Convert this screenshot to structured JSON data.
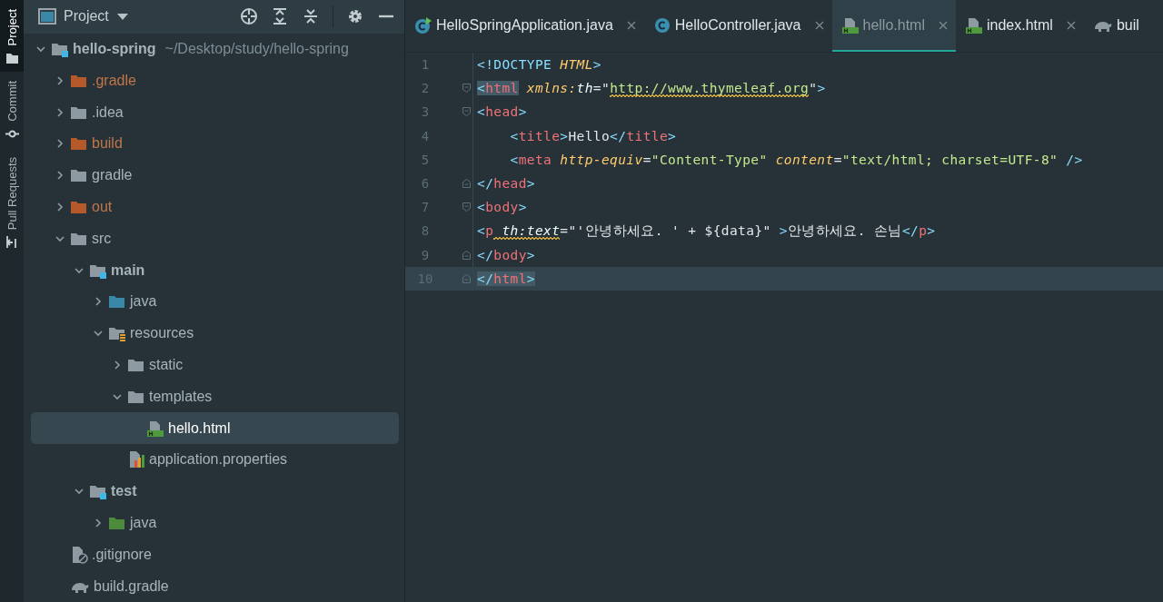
{
  "sidebar_tabs": [
    {
      "label": "Project",
      "kind": "folder",
      "selected": true
    },
    {
      "label": "Commit",
      "kind": "commit",
      "selected": false
    },
    {
      "label": "Pull Requests",
      "kind": "pull-request",
      "selected": false
    }
  ],
  "project_panel": {
    "title": "Project"
  },
  "tree": [
    {
      "name": "hello-spring",
      "path": "~/Desktop/study/hello-spring",
      "kind": "module",
      "expanded": true,
      "selected": false,
      "children": [
        {
          "name": ".gradle",
          "kind": "excluded",
          "expanded": false,
          "selected": false
        },
        {
          "name": ".idea",
          "kind": "folder",
          "expanded": false,
          "selected": false
        },
        {
          "name": "build",
          "kind": "excluded",
          "expanded": false,
          "selected": false
        },
        {
          "name": "gradle",
          "kind": "folder",
          "expanded": false,
          "selected": false
        },
        {
          "name": "out",
          "kind": "excluded",
          "expanded": false,
          "selected": false
        },
        {
          "name": "src",
          "kind": "folder",
          "expanded": true,
          "selected": false,
          "children": [
            {
              "name": "main",
              "kind": "module",
              "expanded": true,
              "selected": false,
              "children": [
                {
                  "name": "java",
                  "kind": "source",
                  "expanded": false,
                  "selected": false
                },
                {
                  "name": "resources",
                  "kind": "resources",
                  "expanded": true,
                  "selected": false,
                  "children": [
                    {
                      "name": "static",
                      "kind": "folder",
                      "expanded": false,
                      "selected": false
                    },
                    {
                      "name": "templates",
                      "kind": "folder",
                      "expanded": true,
                      "selected": false,
                      "children": [
                        {
                          "name": "hello.html",
                          "kind": "html",
                          "selected": true
                        }
                      ]
                    },
                    {
                      "name": "application.properties",
                      "kind": "properties",
                      "selected": false
                    }
                  ]
                }
              ]
            },
            {
              "name": "test",
              "kind": "module",
              "expanded": true,
              "selected": false,
              "children": [
                {
                  "name": "java",
                  "kind": "test-source",
                  "expanded": false,
                  "selected": false
                }
              ]
            }
          ]
        },
        {
          "name": ".gitignore",
          "kind": "gitignore",
          "selected": false
        },
        {
          "name": "build.gradle",
          "kind": "gradle",
          "selected": false
        }
      ]
    }
  ],
  "editor_tabs": [
    {
      "label": "HelloSpringApplication.java",
      "kind": "app",
      "selected": false,
      "closable": true
    },
    {
      "label": "HelloController.java",
      "kind": "class",
      "selected": false,
      "closable": true
    },
    {
      "label": "hello.html",
      "kind": "html",
      "selected": true,
      "closable": true
    },
    {
      "label": "index.html",
      "kind": "html",
      "selected": false,
      "closable": true
    },
    {
      "label": "buil",
      "kind": "gradle",
      "selected": false,
      "closable": false
    }
  ],
  "code_lines": [
    {
      "number": "1",
      "current": false,
      "kind": "plain",
      "tokens": [
        {
          "kind": "bracket",
          "text": "<!DOCTYPE"
        },
        {
          "kind": "attr",
          "text": " HTML"
        },
        {
          "kind": "bracket",
          "text": ">"
        }
      ]
    },
    {
      "number": "2",
      "current": false,
      "kind": "fold-start",
      "tokens": [
        {
          "kind": "bracket",
          "text": "<",
          "matched": true
        },
        {
          "kind": "tag",
          "text": "html",
          "matched": true
        },
        {
          "kind": "attr",
          "text": " xmlns:"
        },
        {
          "kind": "ns",
          "text": "th"
        },
        {
          "kind": "text",
          "text": "=\""
        },
        {
          "kind": "string",
          "text": "http://www.thymeleaf.org",
          "warning": true
        },
        {
          "kind": "text",
          "text": "\""
        },
        {
          "kind": "bracket",
          "text": ">"
        }
      ]
    },
    {
      "number": "3",
      "current": false,
      "kind": "fold-start",
      "tokens": [
        {
          "kind": "bracket",
          "text": "<"
        },
        {
          "kind": "tag",
          "text": "head"
        },
        {
          "kind": "bracket",
          "text": ">"
        }
      ]
    },
    {
      "number": "4",
      "current": false,
      "kind": "plain",
      "tokens": [
        {
          "kind": "bracket",
          "text": "    <"
        },
        {
          "kind": "tag",
          "text": "title"
        },
        {
          "kind": "bracket",
          "text": ">"
        },
        {
          "kind": "text",
          "text": "Hello"
        },
        {
          "kind": "bracket",
          "text": "</"
        },
        {
          "kind": "tag",
          "text": "title"
        },
        {
          "kind": "bracket",
          "text": ">"
        }
      ]
    },
    {
      "number": "5",
      "current": false,
      "kind": "plain",
      "tokens": [
        {
          "kind": "bracket",
          "text": "    <"
        },
        {
          "kind": "tag",
          "text": "meta"
        },
        {
          "kind": "attr",
          "text": " http-equiv"
        },
        {
          "kind": "text",
          "text": "="
        },
        {
          "kind": "string",
          "text": "\"Content-Type\""
        },
        {
          "kind": "attr",
          "text": " content"
        },
        {
          "kind": "text",
          "text": "="
        },
        {
          "kind": "string",
          "text": "\"text/html; charset=UTF-8\""
        },
        {
          "kind": "bracket",
          "text": " />"
        }
      ]
    },
    {
      "number": "6",
      "current": false,
      "kind": "fold-end",
      "tokens": [
        {
          "kind": "bracket",
          "text": "</"
        },
        {
          "kind": "tag",
          "text": "head"
        },
        {
          "kind": "bracket",
          "text": ">"
        }
      ]
    },
    {
      "number": "7",
      "current": false,
      "kind": "fold-start",
      "tokens": [
        {
          "kind": "bracket",
          "text": "<"
        },
        {
          "kind": "tag",
          "text": "body"
        },
        {
          "kind": "bracket",
          "text": ">"
        }
      ]
    },
    {
      "number": "8",
      "current": false,
      "kind": "plain",
      "tokens": [
        {
          "kind": "bracket",
          "text": "<"
        },
        {
          "kind": "tag",
          "text": "p"
        },
        {
          "kind": "ns",
          "text": " th:text",
          "warning": true
        },
        {
          "kind": "text",
          "text": "=\"'안녕하세요. ' + ${data}\""
        },
        {
          "kind": "bracket",
          "text": " >"
        },
        {
          "kind": "text",
          "text": "안녕하세요. 손님"
        },
        {
          "kind": "bracket",
          "text": "</"
        },
        {
          "kind": "tag",
          "text": "p"
        },
        {
          "kind": "bracket",
          "text": ">"
        }
      ]
    },
    {
      "number": "9",
      "current": false,
      "kind": "fold-end",
      "tokens": [
        {
          "kind": "bracket",
          "text": "</"
        },
        {
          "kind": "tag",
          "text": "body"
        },
        {
          "kind": "bracket",
          "text": ">"
        }
      ]
    },
    {
      "number": "10",
      "current": true,
      "kind": "fold-end",
      "tokens": [
        {
          "kind": "bracket",
          "text": "</",
          "matched": true
        },
        {
          "kind": "tag",
          "text": "html",
          "matched": true
        },
        {
          "kind": "bracket",
          "text": ">",
          "matched": true
        }
      ]
    }
  ]
}
